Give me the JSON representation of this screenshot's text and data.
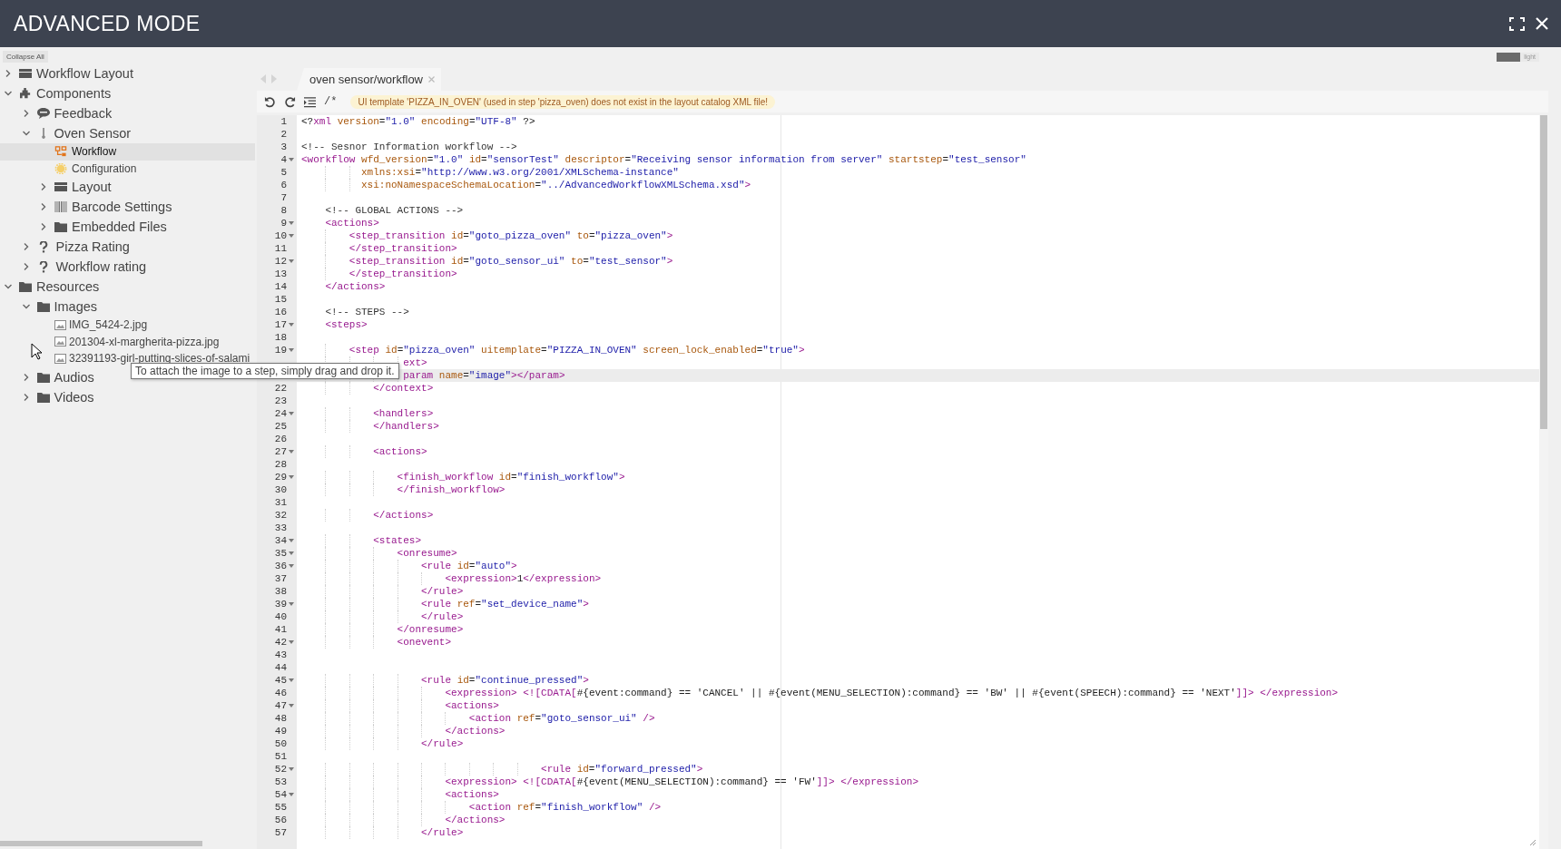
{
  "window": {
    "title": "ADVANCED MODE"
  },
  "sidebar": {
    "collapse_button": "Collapse All",
    "tree": [
      {
        "label": "Workflow Layout",
        "kind": "layout",
        "expanded": false,
        "selected": false
      },
      {
        "label": "Components",
        "kind": "components",
        "expanded": true,
        "selected": false,
        "children": [
          {
            "label": "Feedback",
            "kind": "feedback",
            "expanded": false,
            "selected": false
          },
          {
            "label": "Oven Sensor",
            "kind": "sensor",
            "expanded": true,
            "selected": false,
            "children": [
              {
                "label": "Workflow",
                "kind": "workflow",
                "selected": true
              },
              {
                "label": "Configuration",
                "kind": "configuration",
                "selected": false
              },
              {
                "label": "Layout",
                "kind": "layout",
                "expanded": false,
                "selected": false
              },
              {
                "label": "Barcode Settings",
                "kind": "barcode",
                "expanded": false,
                "selected": false
              },
              {
                "label": "Embedded Files",
                "kind": "folder",
                "expanded": false,
                "selected": false
              }
            ]
          },
          {
            "label": "Pizza Rating",
            "kind": "rating",
            "expanded": false,
            "selected": false
          },
          {
            "label": "Workflow rating",
            "kind": "rating",
            "expanded": false,
            "selected": false
          }
        ]
      },
      {
        "label": "Resources",
        "kind": "folder",
        "expanded": true,
        "selected": false,
        "children": [
          {
            "label": "Images",
            "kind": "folder",
            "expanded": true,
            "selected": false,
            "children": [
              {
                "label": "IMG_5424-2.jpg",
                "kind": "image",
                "selected": false
              },
              {
                "label": "201304-xl-margherita-pizza.jpg",
                "kind": "image",
                "selected": false
              },
              {
                "label": "32391193-girl-putting-slices-of-salami",
                "kind": "image",
                "selected": false
              }
            ]
          },
          {
            "label": "Audios",
            "kind": "folder",
            "expanded": false,
            "selected": false
          },
          {
            "label": "Videos",
            "kind": "folder",
            "expanded": false,
            "selected": false
          }
        ]
      }
    ]
  },
  "theme_toggle": {
    "label": "light",
    "on": false
  },
  "editor": {
    "tabs": [
      {
        "label": "oven sensor/workflow",
        "selected": true
      }
    ],
    "toolbar": {
      "comment_button": "/*",
      "warning": "UI template 'PIZZA_IN_OVEN' (used in step 'pizza_oven) does not exist in the layout catalog XML file!"
    },
    "lines": [
      {
        "number": "1",
        "fold": false,
        "current": false,
        "text": "<?xml version=\"1.0\" encoding=\"UTF-8\" ?>"
      },
      {
        "number": "2",
        "fold": false,
        "current": false
      },
      {
        "number": "3",
        "fold": false,
        "current": false,
        "text": "<!-- Sesnor Information workflow -->"
      },
      {
        "number": "4",
        "fold": true,
        "current": false,
        "text": "<workflow wfd_version=\"1.0\" id=\"sensorTest\" descriptor=\"Receiving sensor information from server\" startstep=\"test_sensor\""
      },
      {
        "number": "5",
        "fold": false,
        "current": false,
        "text": "          xmlns:xsi=\"http://www.w3.org/2001/XMLSchema-instance\""
      },
      {
        "number": "6",
        "fold": false,
        "current": false,
        "text": "          xsi:noNamespaceSchemaLocation=\"../AdvancedWorkflowXMLSchema.xsd\">"
      },
      {
        "number": "7",
        "fold": false,
        "current": false
      },
      {
        "number": "8",
        "fold": false,
        "current": false,
        "text": "    <!-- GLOBAL ACTIONS -->"
      },
      {
        "number": "9",
        "fold": true,
        "current": false,
        "text": "    <actions>"
      },
      {
        "number": "10",
        "fold": true,
        "current": false,
        "text": "        <step_transition id=\"goto_pizza_oven\" to=\"pizza_oven\">"
      },
      {
        "number": "11",
        "fold": false,
        "current": false,
        "text": "        </step_transition>"
      },
      {
        "number": "12",
        "fold": true,
        "current": false,
        "text": "        <step_transition id=\"goto_sensor_ui\" to=\"test_sensor\">"
      },
      {
        "number": "13",
        "fold": false,
        "current": false,
        "text": "        </step_transition>"
      },
      {
        "number": "14",
        "fold": false,
        "current": false,
        "text": "    </actions>"
      },
      {
        "number": "15",
        "fold": false,
        "current": false
      },
      {
        "number": "16",
        "fold": false,
        "current": false,
        "text": "    <!-- STEPS -->"
      },
      {
        "number": "17",
        "fold": true,
        "current": false,
        "text": "    <steps>"
      },
      {
        "number": "18",
        "fold": false,
        "current": false
      },
      {
        "number": "19",
        "fold": true,
        "current": false,
        "text": "        <step id=\"pizza_oven\" uitemplate=\"PIZZA_IN_OVEN\" screen_lock_enabled=\"true\">"
      },
      {
        "fold": false,
        "current": false,
        "text": "                 ext>"
      },
      {
        "fold": false,
        "current": true,
        "text": "                 param name=\"image\"></param>"
      },
      {
        "number": "22",
        "fold": false,
        "current": false,
        "text": "            </context>"
      },
      {
        "number": "23",
        "fold": false,
        "current": false
      },
      {
        "number": "24",
        "fold": true,
        "current": false,
        "text": "            <handlers>"
      },
      {
        "number": "25",
        "fold": false,
        "current": false,
        "text": "            </handlers>"
      },
      {
        "number": "26",
        "fold": false,
        "current": false
      },
      {
        "number": "27",
        "fold": true,
        "current": false,
        "text": "            <actions>"
      },
      {
        "number": "28",
        "fold": false,
        "current": false
      },
      {
        "number": "29",
        "fold": true,
        "current": false,
        "text": "                <finish_workflow id=\"finish_workflow\">"
      },
      {
        "number": "30",
        "fold": false,
        "current": false,
        "text": "                </finish_workflow>"
      },
      {
        "number": "31",
        "fold": false,
        "current": false
      },
      {
        "number": "32",
        "fold": false,
        "current": false,
        "text": "            </actions>"
      },
      {
        "number": "33",
        "fold": false,
        "current": false
      },
      {
        "number": "34",
        "fold": true,
        "current": false,
        "text": "            <states>"
      },
      {
        "number": "35",
        "fold": true,
        "current": false,
        "text": "                <onresume>"
      },
      {
        "number": "36",
        "fold": true,
        "current": false,
        "text": "                    <rule id=\"auto\">"
      },
      {
        "number": "37",
        "fold": false,
        "current": false,
        "text": "                        <expression>1</expression>"
      },
      {
        "number": "38",
        "fold": false,
        "current": false,
        "text": "                    </rule>"
      },
      {
        "number": "39",
        "fold": true,
        "current": false,
        "text": "                    <rule ref=\"set_device_name\">"
      },
      {
        "number": "40",
        "fold": false,
        "current": false,
        "text": "                    </rule>"
      },
      {
        "number": "41",
        "fold": false,
        "current": false,
        "text": "                </onresume>"
      },
      {
        "number": "42",
        "fold": true,
        "current": false,
        "text": "                <onevent>"
      },
      {
        "number": "43",
        "fold": false,
        "current": false
      },
      {
        "number": "44",
        "fold": false,
        "current": false
      },
      {
        "number": "45",
        "fold": true,
        "current": false,
        "text": "                    <rule id=\"continue_pressed\">"
      },
      {
        "number": "46",
        "fold": false,
        "current": false,
        "text": "                        <expression> <![CDATA[#{event:command} == 'CANCEL' || #{event(MENU_SELECTION):command} == 'BW' || #{event(SPEECH):command} == 'NEXT']]> </expression>"
      },
      {
        "number": "47",
        "fold": true,
        "current": false,
        "text": "                        <actions>"
      },
      {
        "number": "48",
        "fold": false,
        "current": false,
        "text": "                            <action ref=\"goto_sensor_ui\" />"
      },
      {
        "number": "49",
        "fold": false,
        "current": false,
        "text": "                        </actions>"
      },
      {
        "number": "50",
        "fold": false,
        "current": false,
        "text": "                    </rule>"
      },
      {
        "number": "51",
        "fold": false,
        "current": false
      },
      {
        "number": "52",
        "fold": true,
        "current": false,
        "text": "                                        <rule id=\"forward_pressed\">"
      },
      {
        "number": "53",
        "fold": false,
        "current": false,
        "text": "                        <expression> <![CDATA[#{event(MENU_SELECTION):command} == 'FW']]> </expression>"
      },
      {
        "number": "54",
        "fold": true,
        "current": false,
        "text": "                        <actions>"
      },
      {
        "number": "55",
        "fold": false,
        "current": false,
        "text": "                            <action ref=\"finish_workflow\" />"
      },
      {
        "number": "56",
        "fold": false,
        "current": false,
        "text": "                        </actions>"
      },
      {
        "number": "57",
        "fold": false,
        "current": false,
        "text": "                    </rule>"
      }
    ]
  },
  "tooltip": {
    "text": "To attach the image to a step, simply drag and drop it."
  }
}
